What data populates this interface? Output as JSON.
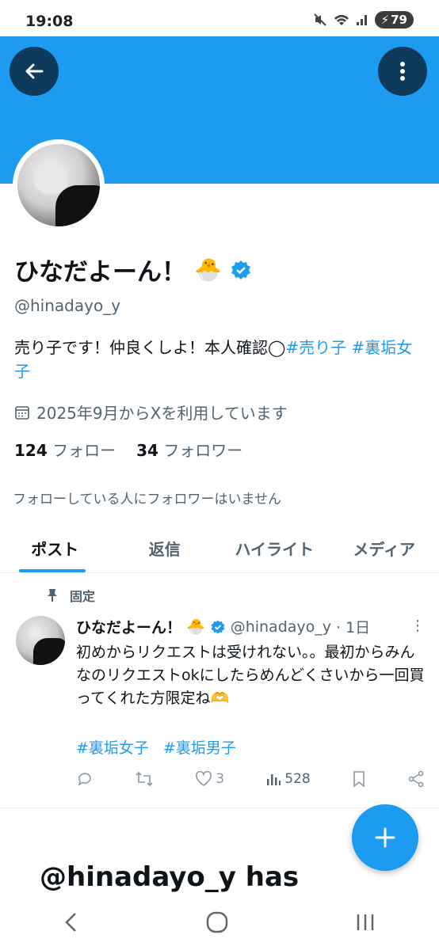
{
  "status_bar": {
    "time": "19:08",
    "battery": "79"
  },
  "profile": {
    "display_name": "ひなだよーん！",
    "name_emoji": "🐣",
    "handle": "@hinadayo_y",
    "bio_text": "売り子です！仲良くしよ！本人確認◯",
    "bio_tag1": "#売り子",
    "bio_tag2": "#裏垢女子",
    "joined": "2025年9月からXを利用しています",
    "following_count": "124",
    "following_label": "フォロー",
    "followers_count": "34",
    "followers_label": "フォロワー",
    "mutual_note": "フォローしている人にフォロワーはいません"
  },
  "tabs": [
    {
      "label": "ポスト",
      "active": true
    },
    {
      "label": "返信",
      "active": false
    },
    {
      "label": "ハイライト",
      "active": false
    },
    {
      "label": "メディア",
      "active": false
    }
  ],
  "pinned_post": {
    "pinned_label": "固定",
    "author_name": "ひなだよーん！",
    "author_emoji": "🐣",
    "author_handle": "@hinadayo_y",
    "time": "· 1日",
    "text": "初めからリクエストは受けれない。。最初からみんなのリクエストokにしたらめんどくさいから一回買ってくれた方限定ね🫶",
    "tags": [
      "#裏垢女子",
      "#裏垢男子"
    ],
    "likes": "3",
    "views": "528"
  },
  "notice_text": "@hinadayo_y has",
  "colors": {
    "accent": "#1d9bf0",
    "banner": "#1d9bf0",
    "text_secondary": "#536471"
  }
}
